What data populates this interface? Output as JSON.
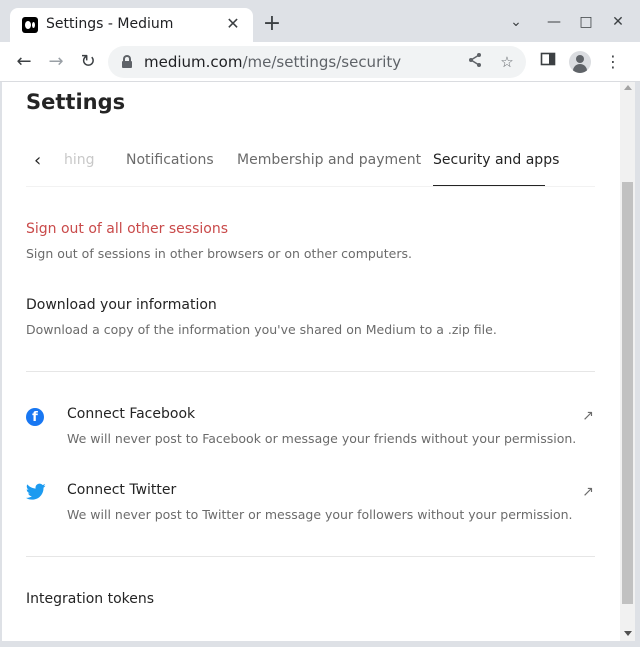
{
  "browser": {
    "tab_title": "Settings - Medium",
    "tab_close": "✕",
    "new_tab": "+",
    "url_host": "medium.com",
    "url_path": "/me/settings/security",
    "window_controls": {
      "dropdown": "⌄",
      "minimize": "—",
      "maximize": "□",
      "close": "✕"
    },
    "nav": {
      "back": "←",
      "forward": "→",
      "reload": "↻"
    },
    "icons": {
      "share": "share-icon",
      "bookmark": "star-icon",
      "sidebar": "side-panel-icon",
      "profile": "profile-icon",
      "menu": "kebab-menu-icon"
    }
  },
  "page": {
    "title": "Settings",
    "tabs": [
      {
        "label": "hing",
        "state": "faded"
      },
      {
        "label": "Notifications",
        "state": "normal"
      },
      {
        "label": "Membership and payment",
        "state": "normal"
      },
      {
        "label": "Security and apps",
        "state": "active"
      }
    ],
    "sections": {
      "signout": {
        "title": "Sign out of all other sessions",
        "desc": "Sign out of sessions in other browsers or on other computers."
      },
      "download": {
        "title": "Download your information",
        "desc": "Download a copy of the information you've shared on Medium to a .zip file."
      },
      "facebook": {
        "title": "Connect Facebook",
        "desc": "We will never post to Facebook or message your friends without your permission.",
        "icon": "f"
      },
      "twitter": {
        "title": "Connect Twitter",
        "desc": "We will never post to Twitter or message your followers without your permission.",
        "icon": "🐦"
      },
      "tokens": {
        "title": "Integration tokens"
      }
    },
    "colors": {
      "danger": "#c94a4a",
      "facebook": "#1877f2",
      "twitter": "#1d9bf0"
    }
  }
}
